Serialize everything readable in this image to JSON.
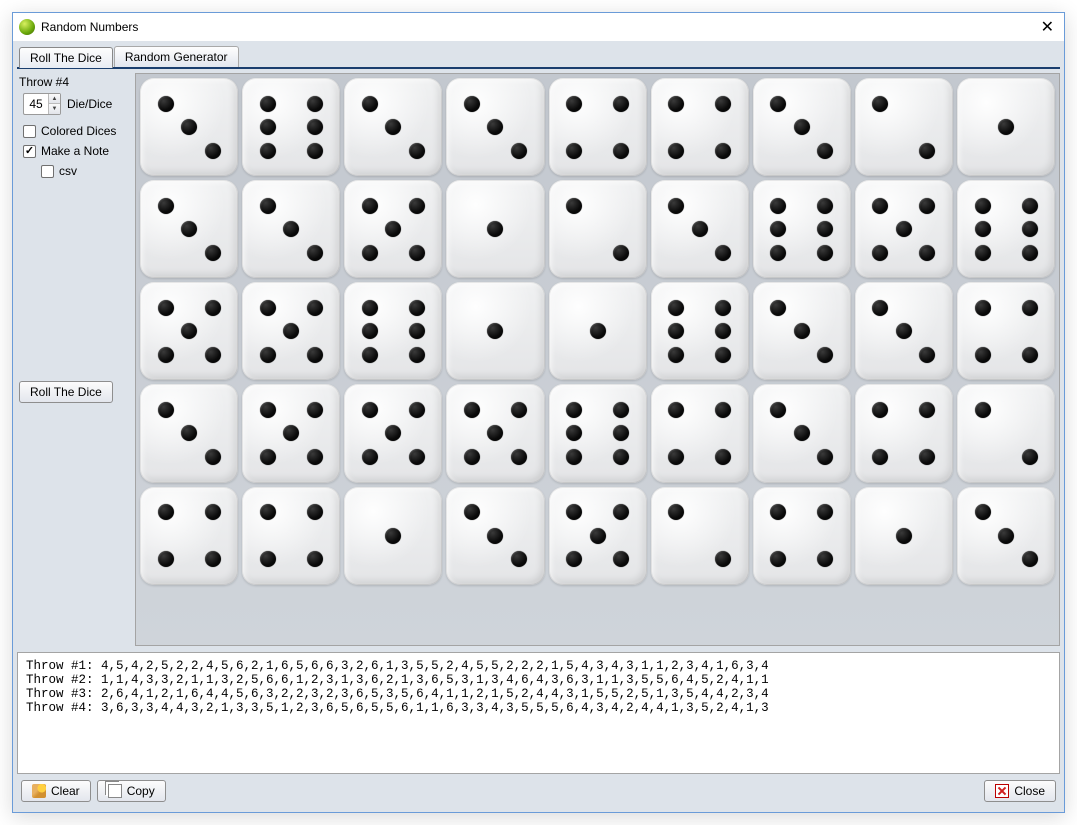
{
  "window": {
    "title": "Random Numbers"
  },
  "tabs": {
    "roll": "Roll The Dice",
    "gen": "Random Generator"
  },
  "side": {
    "throw_label": "Throw #4",
    "dice_count": "45",
    "dice_label": "Die/Dice",
    "colored_label": "Colored Dices",
    "note_label": "Make a Note",
    "csv_label": "csv",
    "roll_btn": "Roll The Dice"
  },
  "dice_values": [
    3,
    6,
    3,
    3,
    4,
    4,
    3,
    2,
    1,
    3,
    3,
    5,
    1,
    2,
    3,
    6,
    5,
    6,
    5,
    5,
    6,
    1,
    1,
    6,
    3,
    3,
    4,
    3,
    5,
    5,
    5,
    6,
    4,
    3,
    4,
    2,
    4,
    4,
    1,
    3,
    5,
    2,
    4,
    1,
    3
  ],
  "notes_lines": [
    "Throw #1: 4,5,4,2,5,2,2,4,5,6,2,1,6,5,6,6,3,2,6,1,3,5,5,2,4,5,5,2,2,2,1,5,4,3,4,3,1,1,2,3,4,1,6,3,4",
    "Throw #2: 1,1,4,3,3,2,1,1,3,2,5,6,6,1,2,3,1,3,6,2,1,3,6,5,3,1,3,4,6,4,3,6,3,1,1,3,5,5,6,4,5,2,4,1,1",
    "Throw #3: 2,6,4,1,2,1,6,4,4,5,6,3,2,2,3,2,3,6,5,3,5,6,4,1,1,2,1,5,2,4,4,3,1,5,5,2,5,1,3,5,4,4,2,3,4",
    "Throw #4: 3,6,3,3,4,4,3,2,1,3,3,5,1,2,3,6,5,6,5,5,6,1,1,6,3,3,4,3,5,5,5,6,4,3,4,2,4,4,1,3,5,2,4,1,3"
  ],
  "buttons": {
    "clear": "Clear",
    "copy": "Copy",
    "close": "Close"
  }
}
